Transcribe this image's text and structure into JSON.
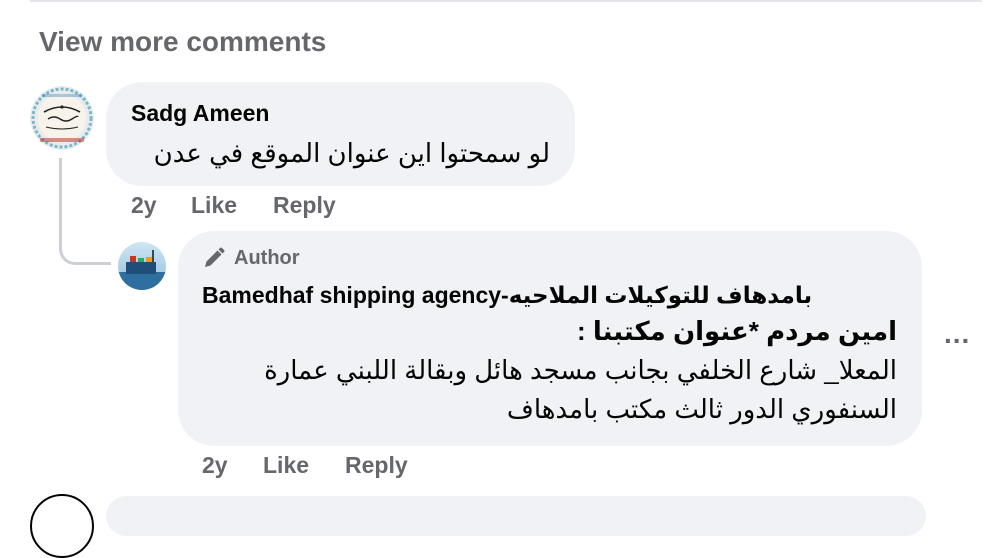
{
  "view_more": "View more comments",
  "comments": [
    {
      "author": "Sadg Ameen",
      "lines": [
        "لو سمحتوا اين عنوان الموقع في عدن"
      ],
      "time": "2y",
      "like": "Like",
      "reply": "Reply"
    },
    {
      "badge": "Author",
      "author": "Bamedhaf shipping agency-بامدهاف للتوكيلات الملاحيه",
      "lines": [
        "امين مردم *عنوان مكتبنا :",
        "المعلا_ شارع الخلفي بجانب مسجد هائل وبقالة اللبني عمارة",
        "السنفوري الدور ثالث مكتب بامدهاف"
      ],
      "time": "2y",
      "like": "Like",
      "reply": "Reply",
      "more": "..."
    }
  ],
  "colors": {
    "bubble": "#f0f2f5",
    "secondary_text": "#65676b",
    "primary_text": "#050505"
  },
  "icons": [
    "profile-avatar-calligraphy",
    "profile-avatar-ship",
    "pen-icon",
    "more-options-icon"
  ]
}
